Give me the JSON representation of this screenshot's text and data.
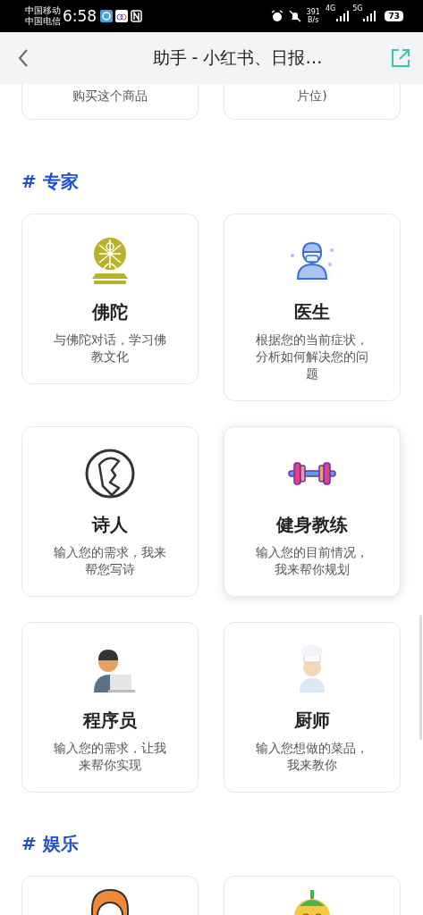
{
  "status_bar": {
    "carriers": [
      "中国移动",
      "中国电信"
    ],
    "time": "6:58",
    "speed": "391",
    "speed_unit": "B/s",
    "network_1": "4G",
    "network_2": "5G",
    "battery": "73"
  },
  "header": {
    "title": "助手 - 小红书、日报…"
  },
  "sections": [
    {
      "cards": [
        {
          "description": "购买这个商品",
          "raised": false
        },
        {
          "description": "片位)",
          "raised": false
        }
      ]
    },
    {
      "heading": "# 专家",
      "cards": [
        {
          "title": "佛陀",
          "description": "与佛陀对话，学习佛教文化",
          "raised": false
        },
        {
          "title": "医生",
          "description": "根据您的当前症状，分析如何解决您的问题",
          "raised": false
        },
        {
          "title": "诗人",
          "description": "输入您的需求，我来帮您写诗",
          "raised": false
        },
        {
          "title": "健身教练",
          "description": "输入您的目前情况，我来帮你规划",
          "raised": true
        },
        {
          "title": "程序员",
          "description": "输入您的需求，让我来帮你实现",
          "raised": false
        },
        {
          "title": "厨师",
          "description": "输入您想做的菜品，我来教你",
          "raised": false
        }
      ]
    },
    {
      "heading": "# 娱乐",
      "cards": [
        {
          "raised": false
        },
        {
          "raised": false
        }
      ]
    }
  ]
}
